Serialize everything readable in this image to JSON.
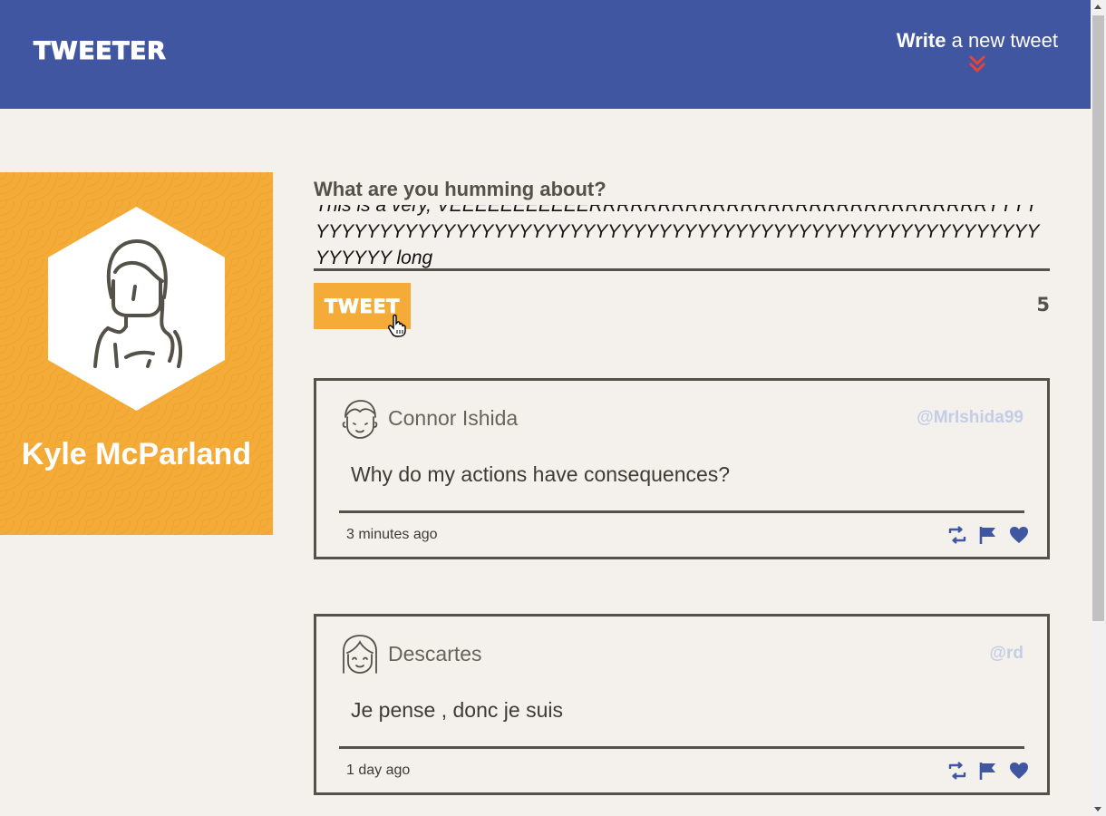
{
  "header": {
    "brand": "TWEETER",
    "compose_toggle": {
      "strong": "Write",
      "rest": " a new tweet",
      "icon": "double-chevron-down-icon"
    }
  },
  "profile": {
    "name": "Kyle McParland",
    "avatar": "woman-avatar-icon"
  },
  "compose": {
    "label": "What are you humming about?",
    "value": "This is a very, VEEEEEEEEEEERRRRRRRRRRRRRRRRRRRRRRRRRRRRRYYYYYYYYYYYYYYYYYYYYYYYYYYYYYYYYYYYYYYYYYYYYYYYYYYYYYYYYYYYYYYYYYYY long",
    "submit_label": "TWEET",
    "char_counter": "5"
  },
  "tweets": [
    {
      "author": "Connor Ishida",
      "handle": "@MrIshida99",
      "text": "Why do my actions have consequences?",
      "time": "3 minutes ago",
      "avatar": "boy-avatar-icon"
    },
    {
      "author": "Descartes",
      "handle": "@rd",
      "text": "Je pense , donc je suis",
      "time": "1 day ago",
      "avatar": "girl-avatar-icon"
    }
  ],
  "colors": {
    "navbar": "#4056a1",
    "background": "#f4f1ec",
    "accent": "#f4ab37",
    "text": "#545149",
    "icon": "#4056a1",
    "chevron": "#e8433a",
    "handle": "#c4cde6"
  }
}
